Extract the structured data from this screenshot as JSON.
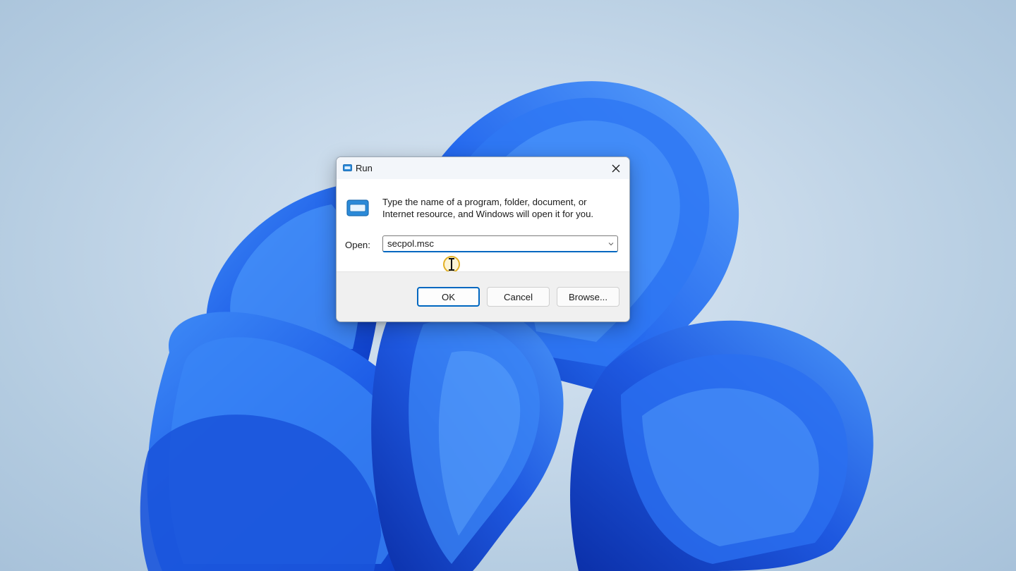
{
  "dialog": {
    "title": "Run",
    "description": "Type the name of a program, folder, document, or Internet resource, and Windows will open it for you.",
    "open_label": "Open:",
    "open_value": "secpol.msc",
    "buttons": {
      "ok": "OK",
      "cancel": "Cancel",
      "browse": "Browse..."
    }
  },
  "colors": {
    "accent": "#0067c0",
    "cursor_highlight": "#e2b024",
    "wallpaper_bloom": "#1f5fe8"
  },
  "icons": {
    "title": "run-app-icon",
    "close": "close-icon",
    "dropdown": "chevron-down-icon",
    "cursor": "text-cursor-icon"
  }
}
